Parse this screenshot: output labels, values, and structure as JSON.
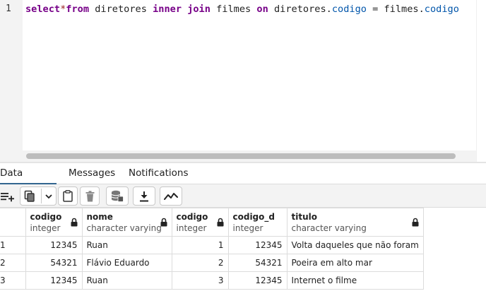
{
  "editor": {
    "line_number": "1",
    "tokens": {
      "kw_select": "select",
      "op_star": "*",
      "kw_from": "from",
      "t_diretores_1": " diretores ",
      "kw_inner": "inner",
      "sp1": " ",
      "kw_join": "join",
      "t_filmes_1": " filmes ",
      "kw_on": "on",
      "t_diretores_2": " diretores.",
      "p_codigo_1": "codigo",
      "t_eq": " = filmes.",
      "p_codigo_2": "codigo"
    }
  },
  "tabs": [
    {
      "label": "Data Output",
      "active": true
    },
    {
      "label": "Messages",
      "active": false
    },
    {
      "label": "Notifications",
      "active": false
    }
  ],
  "toolbar": {
    "buttons": [
      "add-row-icon",
      "copy-icon",
      "dropdown-chevron-icon",
      "paste-icon",
      "delete-icon",
      "save-data-icon",
      "download-icon",
      "graph-visualiser-icon"
    ]
  },
  "grid": {
    "columns": [
      {
        "name": "codigo",
        "type": "integer"
      },
      {
        "name": "nome",
        "type": "character varying"
      },
      {
        "name": "codigo",
        "type": "integer"
      },
      {
        "name": "codigo_d",
        "type": "integer"
      },
      {
        "name": "titulo",
        "type": "character varying"
      }
    ],
    "rows": [
      {
        "n": "1",
        "c1": "12345",
        "c2": "Ruan",
        "c3": "1",
        "c4": "12345",
        "c5": "Volta daqueles que não foram"
      },
      {
        "n": "2",
        "c1": "54321",
        "c2": "Flávio Eduardo",
        "c3": "2",
        "c4": "54321",
        "c5": "Poeira em alto mar"
      },
      {
        "n": "3",
        "c1": "12345",
        "c2": "Ruan",
        "c3": "3",
        "c4": "12345",
        "c5": "Internet o filme"
      }
    ]
  },
  "colors": {
    "keyword": "#770088",
    "property": "#0055aa",
    "active_tab_underline": "#326690"
  }
}
